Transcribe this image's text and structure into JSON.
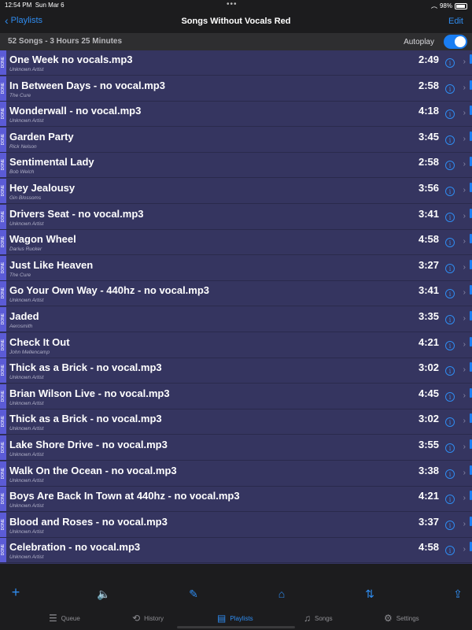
{
  "status": {
    "time": "12:54 PM",
    "date": "Sun Mar 6",
    "battery": "98%"
  },
  "nav": {
    "back_label": "Playlists",
    "title": "Songs Without Vocals Red",
    "edit_label": "Edit"
  },
  "summary": {
    "text": "52 Songs - 3 Hours 25 Minutes",
    "autoplay_label": "Autoplay",
    "autoplay_on": true
  },
  "done_label": "DONE",
  "songs": [
    {
      "title": "One Week no vocals.mp3",
      "artist": "Unknown Artist",
      "duration": "2:49"
    },
    {
      "title": "In Between Days - no vocal.mp3",
      "artist": "The Cure",
      "duration": "2:58"
    },
    {
      "title": "Wonderwall - no vocal.mp3",
      "artist": "Unknown Artist",
      "duration": "4:18"
    },
    {
      "title": "Garden Party",
      "artist": "Rick Nelson",
      "duration": "3:45"
    },
    {
      "title": "Sentimental Lady",
      "artist": "Bob Welch",
      "duration": "2:58"
    },
    {
      "title": "Hey Jealousy",
      "artist": "Gin Blossoms",
      "duration": "3:56"
    },
    {
      "title": "Drivers Seat - no vocal.mp3",
      "artist": "Unknown Artist",
      "duration": "3:41"
    },
    {
      "title": "Wagon Wheel",
      "artist": "Darius Rucker",
      "duration": "4:58"
    },
    {
      "title": "Just Like Heaven",
      "artist": "The Cure",
      "duration": "3:27"
    },
    {
      "title": "Go Your Own Way - 440hz - no vocal.mp3",
      "artist": "Unknown Artist",
      "duration": "3:41"
    },
    {
      "title": "Jaded",
      "artist": "Aerosmith",
      "duration": "3:35"
    },
    {
      "title": "Check It Out",
      "artist": "John Mellencamp",
      "duration": "4:21"
    },
    {
      "title": "Thick as a Brick - no vocal.mp3",
      "artist": "Unknown Artist",
      "duration": "3:02"
    },
    {
      "title": "Brian Wilson Live - no vocal.mp3",
      "artist": "Unknown Artist",
      "duration": "4:45"
    },
    {
      "title": "Thick as a Brick - no vocal.mp3",
      "artist": "Unknown Artist",
      "duration": "3:02"
    },
    {
      "title": "Lake Shore Drive - no vocal.mp3",
      "artist": "Unknown Artist",
      "duration": "3:55"
    },
    {
      "title": "Walk On the Ocean - no vocal.mp3",
      "artist": "Unknown Artist",
      "duration": "3:38"
    },
    {
      "title": "Boys Are Back In Town at 440hz - no vocal.mp3",
      "artist": "Unknown Artist",
      "duration": "4:21"
    },
    {
      "title": "Blood and Roses - no vocal.mp3",
      "artist": "Unknown Artist",
      "duration": "3:37"
    },
    {
      "title": "Celebration - no vocal.mp3",
      "artist": "Unknown Artist",
      "duration": "4:58"
    }
  ],
  "toolbar": {
    "items": [
      {
        "name": "add-icon",
        "glyph": "+"
      },
      {
        "name": "speaker-icon",
        "glyph": "🔈"
      },
      {
        "name": "eyedropper-icon",
        "glyph": "✎"
      },
      {
        "name": "tag-icon",
        "glyph": "⌂"
      },
      {
        "name": "sort-icon",
        "glyph": "⇅"
      },
      {
        "name": "share-icon",
        "glyph": "⇪"
      }
    ]
  },
  "tabs": [
    {
      "label": "Queue",
      "icon": "queue-icon",
      "glyph": "☰",
      "active": false
    },
    {
      "label": "History",
      "icon": "history-icon",
      "glyph": "⟲",
      "active": false
    },
    {
      "label": "Playlists",
      "icon": "playlists-icon",
      "glyph": "▤",
      "active": true
    },
    {
      "label": "Songs",
      "icon": "music-note-icon",
      "glyph": "♫",
      "active": false
    },
    {
      "label": "Settings",
      "icon": "gear-icon",
      "glyph": "⚙",
      "active": false
    }
  ],
  "colors": {
    "accent": "#2f8cf0",
    "list_background": "#353560",
    "done_tag": "#5b5bd6"
  }
}
